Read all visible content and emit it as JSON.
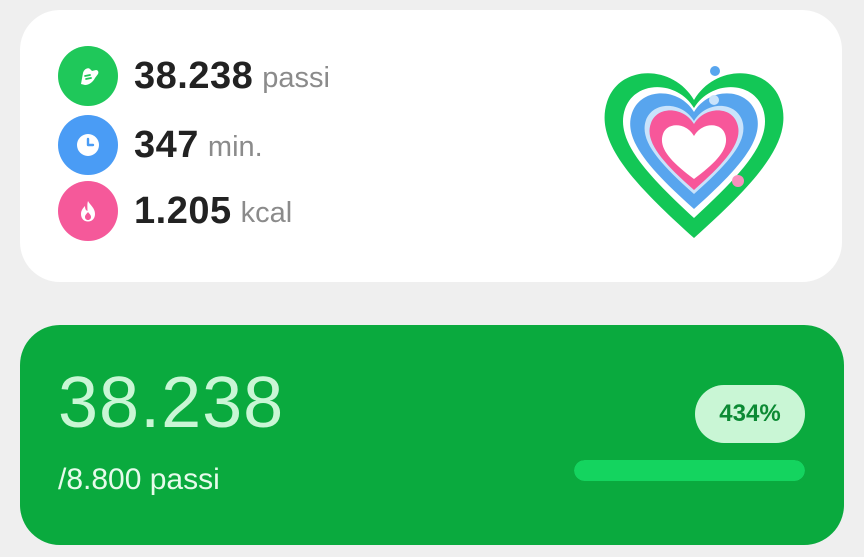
{
  "summary": {
    "steps": {
      "value": "38.238",
      "unit": "passi",
      "icon": "shoe-icon",
      "color": "#1fc85a"
    },
    "minutes": {
      "value": "347",
      "unit": "min.",
      "icon": "clock-icon",
      "color": "#4a9cf5"
    },
    "calories": {
      "value": "1.205",
      "unit": "kcal",
      "icon": "flame-icon",
      "color": "#f5599a"
    }
  },
  "activity_rings": {
    "icon": "heart-rings-icon",
    "colors": [
      "#13c756",
      "#58a5ee",
      "#f7579a"
    ]
  },
  "goal": {
    "count": "38.238",
    "target": "/8.800 passi",
    "percent_label": "434%",
    "progress": 1.0,
    "bar_color": "#14d45f",
    "background_color": "#0aaa3e"
  }
}
